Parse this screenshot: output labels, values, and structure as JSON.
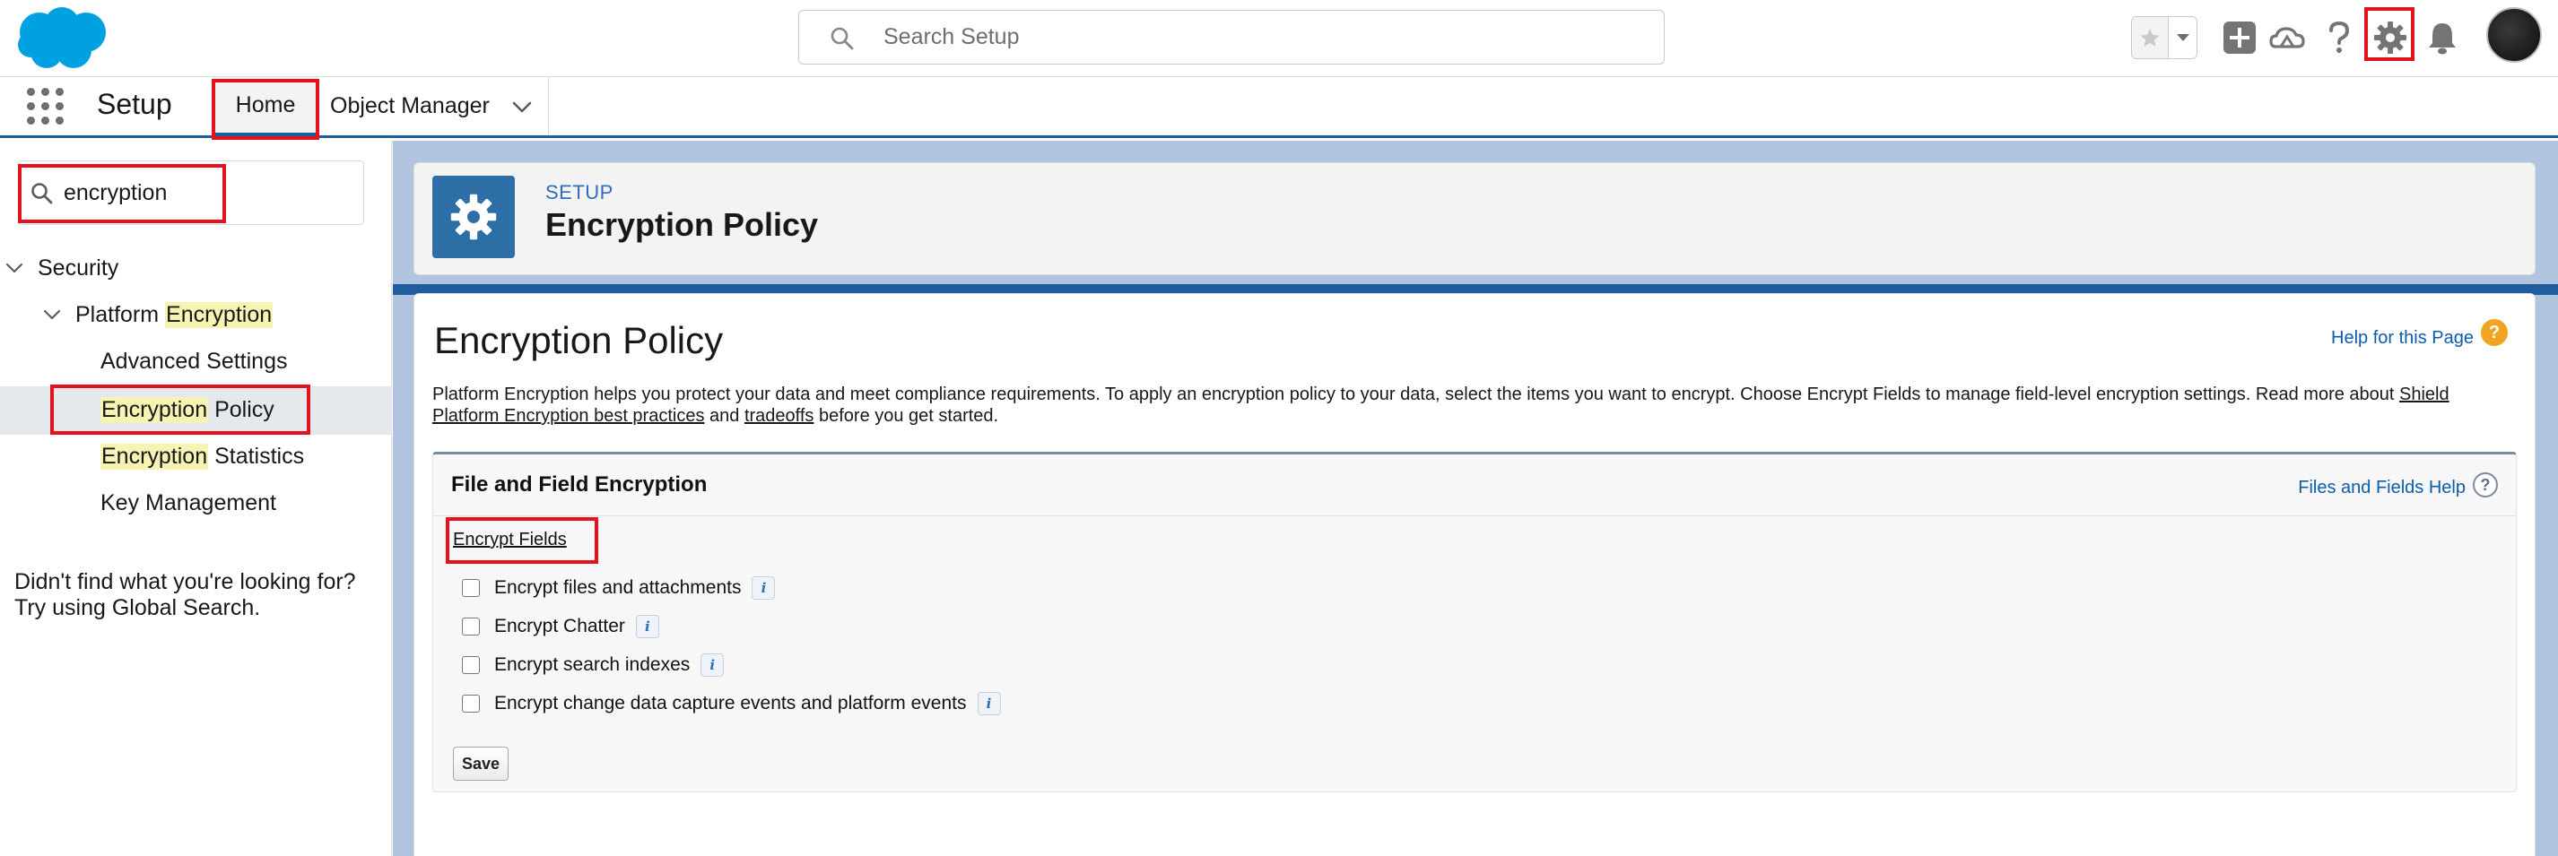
{
  "header": {
    "search_placeholder": "Search Setup",
    "icons": [
      "salesforce-cloud-logo",
      "search-icon",
      "star-icon",
      "chevron-down-icon",
      "plus-icon",
      "trailhead-icon",
      "help-icon",
      "gear-icon",
      "bell-icon",
      "avatar"
    ]
  },
  "nav": {
    "app_name": "Setup",
    "tabs": [
      {
        "label": "Home"
      },
      {
        "label": "Object Manager"
      }
    ]
  },
  "sidebar": {
    "quick_find_value": "encryption",
    "tree": {
      "security": "Security",
      "platform_prefix": "Platform ",
      "platform_hl": "Encryption",
      "advanced_settings": "Advanced Settings",
      "policy_hl": "Encryption",
      "policy_suffix": " Policy",
      "stats_hl": "Encryption",
      "stats_suffix": " Statistics",
      "key_management": "Key Management"
    },
    "note_line1": "Didn't find what you're looking for?",
    "note_line2": "Try using Global Search."
  },
  "page_header": {
    "eyebrow": "SETUP",
    "title": "Encryption Policy"
  },
  "content": {
    "title": "Encryption Policy",
    "help_link": "Help for this Page",
    "intro_1": "Platform Encryption helps you protect your data and meet compliance requirements. To apply an encryption policy to your data, select the items you want to encrypt. Choose Encrypt Fields to manage field-level encryption settings. Read more about ",
    "intro_link1": "Shield Platform Encryption best practices",
    "intro_2": " and ",
    "intro_link2": "tradeoffs",
    "intro_3": " before you get started.",
    "section_title": "File and Field Encryption",
    "section_help": "Files and Fields Help",
    "encrypt_fields_link": "Encrypt Fields",
    "options": [
      {
        "label": "Encrypt files and attachments",
        "checked": false
      },
      {
        "label": "Encrypt Chatter",
        "checked": false
      },
      {
        "label": "Encrypt search indexes",
        "checked": false
      },
      {
        "label": "Encrypt change data capture events and platform events",
        "checked": false
      }
    ],
    "save_label": "Save"
  },
  "colors": {
    "brand_blue": "#00a1e0",
    "highlight_red": "#e3121b",
    "header_tile": "#2c6ea5",
    "link_blue": "#0b5cab",
    "search_highlight": "#f6f4b2"
  }
}
